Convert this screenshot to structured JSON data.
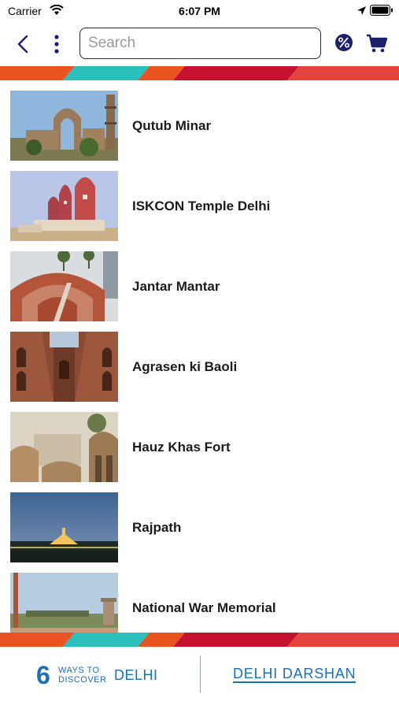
{
  "status_bar": {
    "carrier": "Carrier",
    "time": "6:07 PM"
  },
  "nav": {
    "search_placeholder": "Search"
  },
  "colors": {
    "accent_blue": "#1d6fb8",
    "nav_icon": "#1a1f6e",
    "stripe": [
      "#e8531f",
      "#2bc0bb",
      "#e8531f",
      "#c4122f",
      "#e5433f"
    ]
  },
  "places": [
    {
      "name": "Qutub Minar",
      "image": "qutub-minar-photo"
    },
    {
      "name": "ISKCON Temple Delhi",
      "image": "iskcon-temple-photo"
    },
    {
      "name": "Jantar Mantar",
      "image": "jantar-mantar-photo"
    },
    {
      "name": "Agrasen ki Baoli",
      "image": "agrasen-baoli-photo"
    },
    {
      "name": "Hauz Khas Fort",
      "image": "hauz-khas-photo"
    },
    {
      "name": "Rajpath",
      "image": "rajpath-photo"
    },
    {
      "name": "National War Memorial",
      "image": "war-memorial-photo"
    }
  ],
  "footer": {
    "six": "6",
    "ways": "WAYS TO",
    "discover": "DISCOVER",
    "delhi": "DELHI",
    "darshan": "DELHI DARSHAN"
  }
}
